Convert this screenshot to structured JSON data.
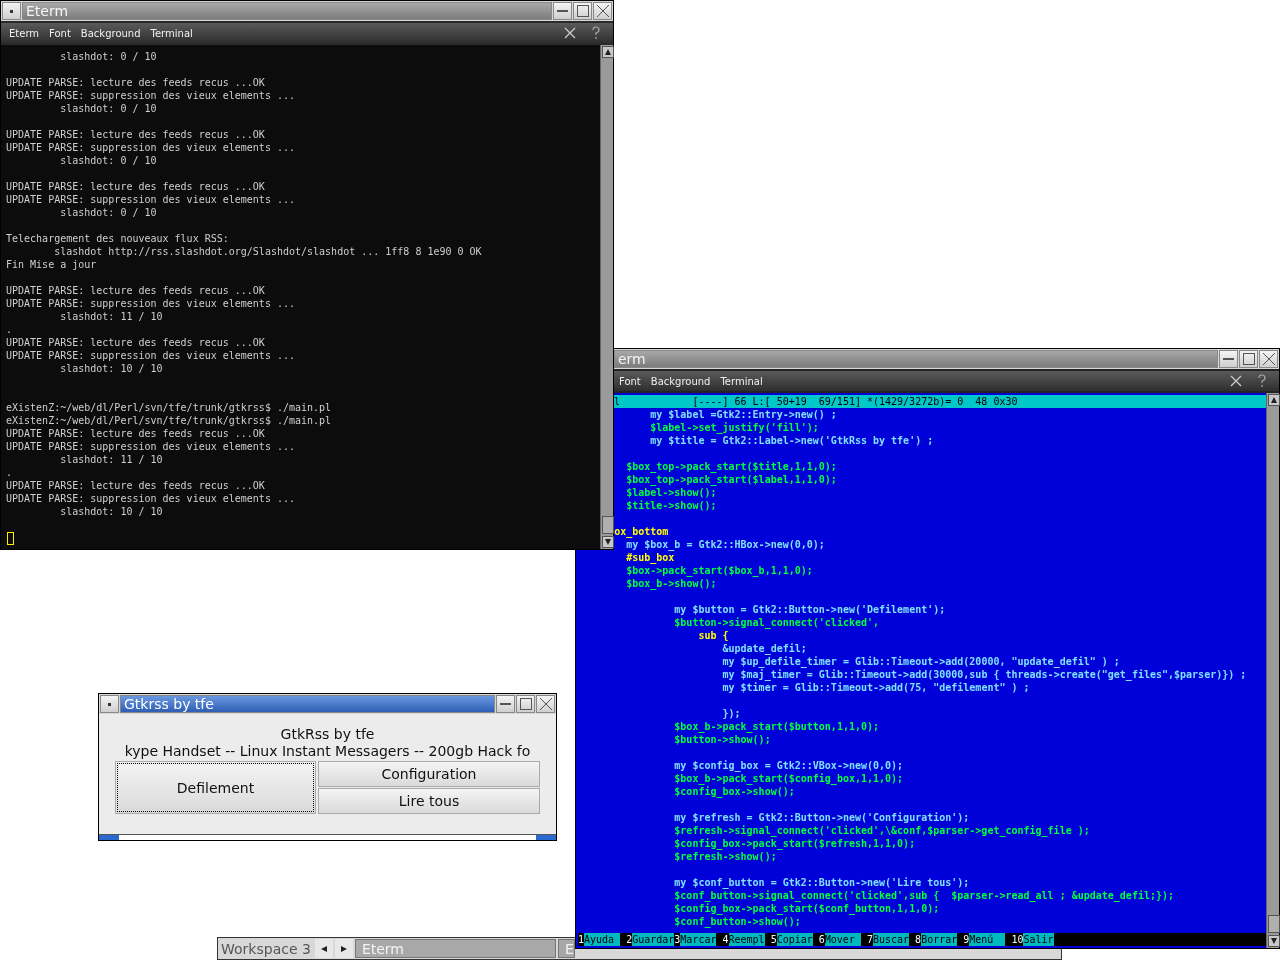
{
  "terminal_window": {
    "title": "Eterm",
    "menu": [
      "Eterm",
      "Font",
      "Background",
      "Terminal"
    ],
    "lines": [
      {
        "kind": "text",
        "text": "         slashdot: 0 / 10"
      },
      {
        "kind": "blank"
      },
      {
        "kind": "text",
        "text": "UPDATE PARSE: lecture des feeds recus ...OK"
      },
      {
        "kind": "text",
        "text": "UPDATE PARSE: suppression des vieux elements ..."
      },
      {
        "kind": "text",
        "text": "         slashdot: 0 / 10"
      },
      {
        "kind": "blank"
      },
      {
        "kind": "text",
        "text": "UPDATE PARSE: lecture des feeds recus ...OK"
      },
      {
        "kind": "text",
        "text": "UPDATE PARSE: suppression des vieux elements ..."
      },
      {
        "kind": "text",
        "text": "         slashdot: 0 / 10"
      },
      {
        "kind": "blank"
      },
      {
        "kind": "text",
        "text": "UPDATE PARSE: lecture des feeds recus ...OK"
      },
      {
        "kind": "text",
        "text": "UPDATE PARSE: suppression des vieux elements ..."
      },
      {
        "kind": "text",
        "text": "         slashdot: 0 / 10"
      },
      {
        "kind": "blank"
      },
      {
        "kind": "text",
        "text": "Telechargement des nouveaux flux RSS:"
      },
      {
        "kind": "text",
        "text": "        slashdot http://rss.slashdot.org/Slashdot/slashdot ... 1ff8 8 1e90 0 OK"
      },
      {
        "kind": "text",
        "text": "Fin Mise a jour"
      },
      {
        "kind": "blank"
      },
      {
        "kind": "text",
        "text": "UPDATE PARSE: lecture des feeds recus ...OK"
      },
      {
        "kind": "text",
        "text": "UPDATE PARSE: suppression des vieux elements ..."
      },
      {
        "kind": "text",
        "text": "         slashdot: 11 / 10"
      },
      {
        "kind": "text",
        "text": "."
      },
      {
        "kind": "text",
        "text": "UPDATE PARSE: lecture des feeds recus ...OK"
      },
      {
        "kind": "text",
        "text": "UPDATE PARSE: suppression des vieux elements ..."
      },
      {
        "kind": "text",
        "text": "         slashdot: 10 / 10"
      },
      {
        "kind": "blank"
      },
      {
        "kind": "blank"
      },
      {
        "kind": "text",
        "text": "eXistenZ:~/web/dl/Perl/svn/tfe/trunk/gtkrss$ ./main.pl"
      },
      {
        "kind": "text",
        "text": "eXistenZ:~/web/dl/Perl/svn/tfe/trunk/gtkrss$ ./main.pl"
      },
      {
        "kind": "text",
        "text": "UPDATE PARSE: lecture des feeds recus ...OK"
      },
      {
        "kind": "text",
        "text": "UPDATE PARSE: suppression des vieux elements ..."
      },
      {
        "kind": "text",
        "text": "         slashdot: 11 / 10"
      },
      {
        "kind": "text",
        "text": "."
      },
      {
        "kind": "text",
        "text": "UPDATE PARSE: lecture des feeds recus ...OK"
      },
      {
        "kind": "text",
        "text": "UPDATE PARSE: suppression des vieux elements ..."
      },
      {
        "kind": "text",
        "text": "         slashdot: 10 / 10"
      },
      {
        "kind": "blank"
      }
    ]
  },
  "editor_window": {
    "title": "erm",
    "menu": [
      "Font",
      "Background",
      "Terminal"
    ],
    "status_line": "l            [----] 66 L:[ 50+19  69/151] *(1429/3272b)= 0  48 0x30",
    "lines": [
      {
        "kind": "code",
        "text": "            my $label =Gtk2::Entry->new() ;",
        "color": "#7fe0ff"
      },
      {
        "kind": "code",
        "text": "            $label->set_justify('fill');",
        "color": "#00ff3c"
      },
      {
        "kind": "code",
        "text": "            my $title = Gtk2::Label->new('GtkRss by tfe') ;",
        "color": "#7fe0ff"
      },
      {
        "kind": "blank"
      },
      {
        "kind": "code",
        "text": "        $box_top->pack_start($title,1,1,0);",
        "color": "#00ff3c"
      },
      {
        "kind": "code",
        "text": "        $box_top->pack_start($label,1,1,0);",
        "color": "#00ff3c"
      },
      {
        "kind": "code",
        "text": "        $label->show();",
        "color": "#00ff3c"
      },
      {
        "kind": "code",
        "text": "        $title->show();",
        "color": "#00ff3c"
      },
      {
        "kind": "blank"
      },
      {
        "kind": "code",
        "text": "      ox_bottom",
        "color": "#ffff00"
      },
      {
        "kind": "code",
        "text": "        my $box_b = Gtk2::HBox->new(0,0);",
        "color": "#7fe0ff"
      },
      {
        "kind": "code",
        "text": "        #sub_box",
        "color": "#ffff00"
      },
      {
        "kind": "code",
        "text": "        $box->pack_start($box_b,1,1,0);",
        "color": "#00ff3c"
      },
      {
        "kind": "code",
        "text": "        $box_b->show();",
        "color": "#00ff3c"
      },
      {
        "kind": "blank"
      },
      {
        "kind": "code",
        "text": "                my $button = Gtk2::Button->new('Defilement');",
        "color": "#7fe0ff"
      },
      {
        "kind": "code",
        "text": "                $button->signal_connect('clicked',",
        "color": "#00ff3c"
      },
      {
        "kind": "code",
        "text": "                    sub {",
        "color": "#ffff00"
      },
      {
        "kind": "code",
        "text": "                        &update_defil;",
        "color": "#7fe0ff"
      },
      {
        "kind": "code",
        "text": "                        my $up_defile_timer = Glib::Timeout->add(20000, \"update_defil\" ) ;",
        "color": "#7fe0ff"
      },
      {
        "kind": "code",
        "text": "                        my $maj_timer = Glib::Timeout->add(30000,sub { threads->create(\"get_files\",$parser)}) ;",
        "color": "#7fe0ff"
      },
      {
        "kind": "code",
        "text": "                        my $timer = Glib::Timeout->add(75, \"defilement\" ) ;",
        "color": "#7fe0ff"
      },
      {
        "kind": "blank"
      },
      {
        "kind": "code",
        "text": "                        });",
        "color": "#7fe0ff"
      },
      {
        "kind": "code",
        "text": "                $box_b->pack_start($button,1,1,0);",
        "color": "#00ff3c"
      },
      {
        "kind": "code",
        "text": "                $button->show();",
        "color": "#00ff3c"
      },
      {
        "kind": "blank"
      },
      {
        "kind": "code",
        "text": "                my $config_box = Gtk2::VBox->new(0,0);",
        "color": "#7fe0ff"
      },
      {
        "kind": "code",
        "text": "                $box_b->pack_start($config_box,1,1,0);",
        "color": "#00ff3c"
      },
      {
        "kind": "code",
        "text": "                $config_box->show();",
        "color": "#00ff3c"
      },
      {
        "kind": "blank"
      },
      {
        "kind": "code",
        "text": "                my $refresh = Gtk2::Button->new('Configuration');",
        "color": "#7fe0ff"
      },
      {
        "kind": "code",
        "text": "                $refresh->signal_connect('clicked',\\&conf,$parser->get_config_file );",
        "color": "#00ff3c"
      },
      {
        "kind": "code",
        "text": "                $config_box->pack_start($refresh,1,1,0);",
        "color": "#00ff3c"
      },
      {
        "kind": "code",
        "text": "                $refresh->show();",
        "color": "#00ff3c"
      },
      {
        "kind": "blank"
      },
      {
        "kind": "code",
        "text": "                my $conf_button = Gtk2::Button->new('Lire tous');",
        "color": "#7fe0ff"
      },
      {
        "kind": "code",
        "text": "                $conf_button->signal_connect('clicked',sub {  $parser->read_all ; &update_defil;});",
        "color": "#00ff3c"
      },
      {
        "kind": "code",
        "text": "                $config_box->pack_start($conf_button,1,1,0);",
        "color": "#00ff3c"
      },
      {
        "kind": "code",
        "text": "                $conf_button->show();",
        "color": "#00ff3c"
      }
    ],
    "function_keys": [
      {
        "key": "1",
        "label": "Ayuda"
      },
      {
        "key": "2",
        "label": "Guardar"
      },
      {
        "key": "3",
        "label": "Marcar"
      },
      {
        "key": "4",
        "label": "Reempl"
      },
      {
        "key": "5",
        "label": "Copiar"
      },
      {
        "key": "6",
        "label": "Mover"
      },
      {
        "key": "7",
        "label": "Buscar"
      },
      {
        "key": "8",
        "label": "Borrar"
      },
      {
        "key": "9",
        "label": "Menú"
      },
      {
        "key": "10",
        "label": "Salir"
      }
    ]
  },
  "dialog": {
    "title": "Gtkrss by tfe",
    "heading": "GtkRss by tfe",
    "ticker": "kype Handset -- Linux Instant Messagers -- 200gb Hack fo",
    "buttons": [
      {
        "label": "Defilement",
        "focused": true
      },
      {
        "label": "Configuration",
        "focused": false
      },
      {
        "label": "Lire tous",
        "focused": false
      }
    ]
  },
  "taskbar": {
    "workspace": "Workspace 3",
    "tasks": [
      "Eterm",
      "E"
    ]
  }
}
